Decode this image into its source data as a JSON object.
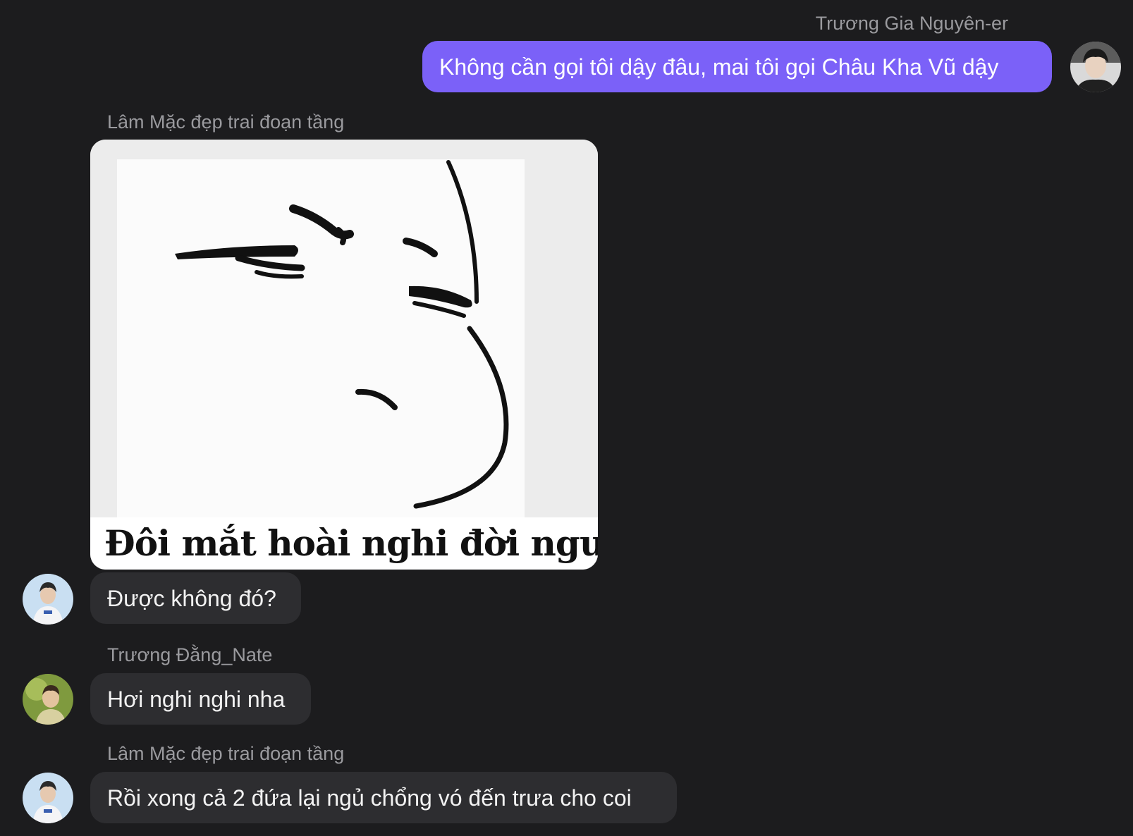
{
  "messages": [
    {
      "sender": "Trương Gia Nguyên-er",
      "text": "Không cần gọi tôi dậy đâu, mai tôi gọi Châu Kha Vũ dậy"
    },
    {
      "sender": "Lâm Mặc đẹp trai đoạn tầng",
      "sticker_caption": "Đôi mắt hoài nghi đời người"
    },
    {
      "text": "Được không đó?"
    },
    {
      "sender": "Trương Đằng_Nate",
      "text": "Hơi nghi nghi nha"
    },
    {
      "sender": "Lâm Mặc đẹp trai đoạn tầng",
      "text": "Rồi xong cả 2 đứa lại ngủ chổng vó đến trưa cho coi"
    }
  ],
  "colors": {
    "background": "#1c1c1e",
    "outgoing_bubble": "#7b61f8",
    "incoming_bubble": "#2d2d30",
    "sender_name": "#9a9a9e"
  }
}
